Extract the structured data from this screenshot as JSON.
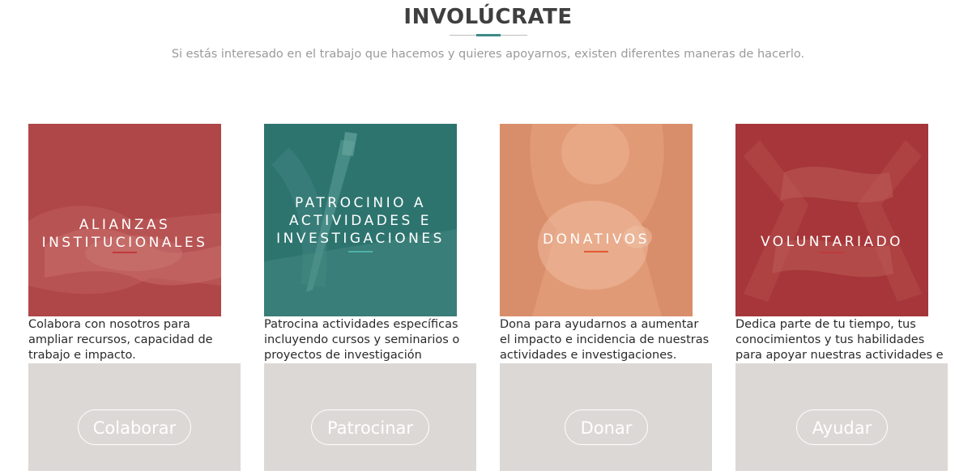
{
  "header": {
    "title": "INVOLÚCRATE",
    "subtitle": "Si estás interesado en el trabajo que hacemos y quieres apoyarnos, existen diferentes maneras de hacerlo."
  },
  "colors": {
    "title_accent": "#3c8a88",
    "tile_red": "#b14a4b",
    "tile_teal": "#2f7672",
    "tile_peach": "#e4a07e",
    "tile_darkred": "#a93a3c",
    "button_panel": "#dcd8d5"
  },
  "cards": [
    {
      "tile_label": "ALIANZAS INSTITUCIONALES",
      "description": "Colabora con nosotros para ampliar recursos, capacidad de trabajo e impacto.",
      "button_label": "Colaborar",
      "icon": "handshake-photo"
    },
    {
      "tile_label": "PATROCINIO A ACTIVIDADES E INVESTIGACIONES",
      "description": "Patrocina actividades específicas incluyendo cursos y seminarios o proyectos de investigación particulares.",
      "button_label": "Patrocinar",
      "icon": "pen-writing-photo"
    },
    {
      "tile_label": "DONATIVOS",
      "description": "Dona para ayudarnos a aumentar el impacto e incidencia de nuestras actividades e investigaciones.",
      "button_label": "Donar",
      "icon": "piggy-bank-photo"
    },
    {
      "tile_label": "VOLUNTARIADO",
      "description": "Dedica parte de tu tiempo, tus conocimientos y tus habilidades para apoyar nuestras actividades e iniciativas.",
      "button_label": "Ayudar",
      "icon": "linked-hands-photo"
    }
  ]
}
